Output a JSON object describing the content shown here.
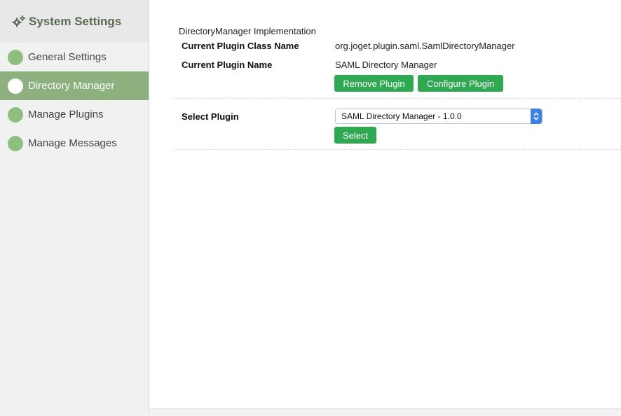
{
  "sidebar": {
    "title": "System Settings",
    "header_icon": "gears-icon",
    "items": [
      {
        "label": "General Settings",
        "active": false
      },
      {
        "label": "Directory Manager",
        "active": true
      },
      {
        "label": "Manage Plugins",
        "active": false
      },
      {
        "label": "Manage Messages",
        "active": false
      }
    ]
  },
  "main": {
    "section_title": "DirectoryManager Implementation",
    "current_class_label": "Current Plugin Class Name",
    "current_class_value": "org.joget.plugin.saml.SamlDirectoryManager",
    "current_name_label": "Current Plugin Name",
    "current_name_value": "SAML Directory Manager",
    "remove_button": "Remove Plugin",
    "configure_button": "Configure Plugin",
    "select_plugin_label": "Select Plugin",
    "select_value": "SAML Directory Manager - 1.0.0",
    "select_button": "Select"
  },
  "colors": {
    "accent_green": "#2ea851",
    "nav_active": "#8db07f",
    "nav_dot": "#8fbf7f",
    "sidebar_title": "#5b6a53",
    "select_arrow": "#3b82e8"
  }
}
